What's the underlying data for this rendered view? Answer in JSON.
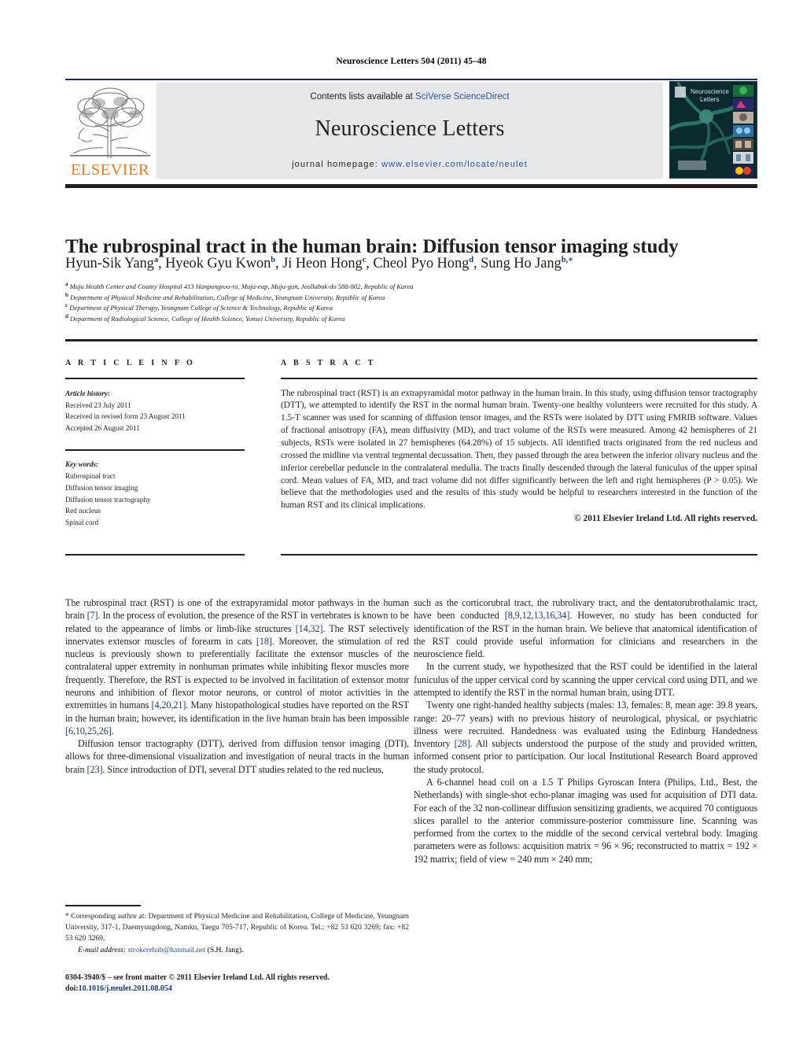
{
  "running_head": "Neuroscience Letters 504 (2011) 45–48",
  "masthead": {
    "contents_prefix": "Contents lists available at ",
    "contents_link": "SciVerse ScienceDirect",
    "journal_title": "Neuroscience Letters",
    "homepage_prefix": "journal homepage: ",
    "homepage_url": "www.elsevier.com/locate/neulet",
    "publisher_logo_text": "ELSEVIER",
    "cover_title_line1": "Neuroscience",
    "cover_title_line2": "Letters",
    "accent_blue": "#2b55a3",
    "elsevier_orange": "#ec7c22",
    "masthead_bg": "#e6e7e8",
    "cover_bg": "#0d2b33"
  },
  "article": {
    "title": "The rubrospinal tract in the human brain: Diffusion tensor imaging study",
    "authors": [
      {
        "name": "Hyun-Sik Yang",
        "sup": "a",
        "sep": ", "
      },
      {
        "name": "Hyeok Gyu Kwon",
        "sup": "b",
        "sep": ", "
      },
      {
        "name": "Ji Heon Hong",
        "sup": "c",
        "sep": ", "
      },
      {
        "name": "Cheol Pyo Hong",
        "sup": "d",
        "sep": ", "
      },
      {
        "name": "Sung Ho Jang",
        "sup": "b,∗",
        "sep": ""
      }
    ],
    "affiliations": [
      {
        "label": "a",
        "text": "Muju Health Center and County Hospital 413 Hanpungroo-ro, Muju-eup, Muju-gun, Jeollabuk-do 588-802, Republic of Korea"
      },
      {
        "label": "b",
        "text": "Department of Physical Medicine and Rehabilitation, College of Medicine, Yeungnam University, Republic of Korea"
      },
      {
        "label": "c",
        "text": "Department of Physical Therapy, Yeungnam College of Science & Technology, Republic of Korea"
      },
      {
        "label": "d",
        "text": "Department of Radiological Science, College of Health Science, Yonsei University, Republic of Korea"
      }
    ]
  },
  "article_info": {
    "heading": "A R T I C L E  I N F O",
    "history_label": "Article history:",
    "history": [
      "Received 23 July 2011",
      "Received in revised form 23 August 2011",
      "Accepted 26 August 2011"
    ],
    "keywords_label": "Key words:",
    "keywords": [
      "Rubrospinal tract",
      "Diffusion tensor imaging",
      "Diffusion tensor tractography",
      "Red nucleus",
      "Spinal cord"
    ]
  },
  "abstract": {
    "heading": "A B S T R A C T",
    "text": "The rubrospinal tract (RST) is an extrapyramidal motor pathway in the human brain. In this study, using diffusion tensor tractography (DTT), we attempted to identify the RST in the normal human brain. Twenty-one healthy volunteers were recruited for this study. A 1.5-T scanner was used for scanning of diffusion tensor images, and the RSTs were isolated by DTT using FMRIB software. Values of fractional anisotropy (FA), mean diffusivity (MD), and tract volume of the RSTs were measured. Among 42 hemispheres of 21 subjects, RSTs were isolated in 27 hemispheres (64.28%) of 15 subjects. All identified tracts originated from the red nucleus and crossed the midline via ventral tegmental decussation. Then, they passed through the area between the inferior olivary nucleus and the inferior cerebellar peduncle in the contralateral medulla. The tracts finally descended through the lateral funiculus of the upper spinal cord. Mean values of FA, MD, and tract volume did not differ significantly between the left and right hemispheres (P > 0.05). We believe that the methodologies used and the results of this study would be helpful to researchers interested in the function of the human RST and its clinical implications.",
    "copyright": "© 2011 Elsevier Ireland Ltd. All rights reserved."
  },
  "body": {
    "left_column": [
      "The rubrospinal tract (RST) is one of the extrapyramidal motor pathways in the human brain [7]. In the process of evolution, the presence of the RST in vertebrates is known to be related to the appearance of limbs or limb-like structures [14,32]. The RST selectively innervates extensor muscles of forearm in cats [18]. Moreover, the stimulation of red nucleus is previously shown to preferentially facilitate the extensor muscles of the contralateral upper extremity in nonhuman primates while inhibiting flexor muscles more frequently. Therefore, the RST is expected to be involved in facilitation of extensor motor neurons and inhibition of flexor motor neurons, or control of motor activities in the extremities in humans [4,20,21]. Many histopathological studies have reported on the RST in the human brain; however, its identification in the live human brain has been impossible [6,10,25,26].",
      "Diffusion tensor tractography (DTT), derived from diffusion tensor imaging (DTI), allows for three-dimensional visualization and investigation of neural tracts in the human brain [23]. Since introduction of DTI, several DTT studies related to the red nucleus,"
    ],
    "right_column": [
      "such as the corticorubral tract, the rubrolivary tract, and the dentatorubrothalamic tract, have been conducted [8,9,12,13,16,34]. However, no study has been conducted for identification of the RST in the human brain. We believe that anatomical identification of the RST could provide useful information for clinicians and researchers in the neuroscience field.",
      "In the current study, we hypothesized that the RST could be identified in the lateral funiculus of the upper cervical cord by scanning the upper cervical cord using DTI, and we attempted to identify the RST in the normal human brain, using DTT.",
      "Twenty one right-handed healthy subjects (males: 13, females: 8, mean age: 39.8 years, range: 20–77 years) with no previous history of neurological, physical, or psychiatric illness were recruited. Handedness was evaluated using the Edinburg Handedness Inventory [28]. All subjects understood the purpose of the study and provided written, informed consent prior to participation. Our local Institutional Research Board approved the study protocol.",
      "A 6-channel head coil on a 1.5 T Philips Gyroscan Intera (Philips, Ltd., Best, the Netherlands) with single-shot echo-planar imaging was used for acquisition of DTI data. For each of the 32 non-collinear diffusion sensitizing gradients, we acquired 70 contiguous slices parallel to the anterior commissure-posterior commissure line. Scanning was performed from the cortex to the middle of the second cervical vertebral body. Imaging parameters were as follows: acquisition matrix = 96 × 96; reconstructed to matrix = 192 × 192 matrix; field of view = 240 mm × 240 mm;"
    ]
  },
  "footnotes": {
    "corresponding": "* Corresponding author at: Department of Physical Medicine and Rehabilitation, College of Medicine, Yeungnam University, 317-1, Daemyungdong, Namku, Taegu 705-717, Republic of Korea. Tel.: +82 53 620 3269; fax: +82 53 620 3269.",
    "email_label": "E-mail address:",
    "email": "strokerehab@hanmail.net",
    "email_owner": "(S.H. Jang).",
    "issn_line": "0304-3940/$ – see front matter © 2011 Elsevier Ireland Ltd. All rights reserved.",
    "doi_label": "doi:",
    "doi": "10.1016/j.neulet.2011.08.054"
  }
}
